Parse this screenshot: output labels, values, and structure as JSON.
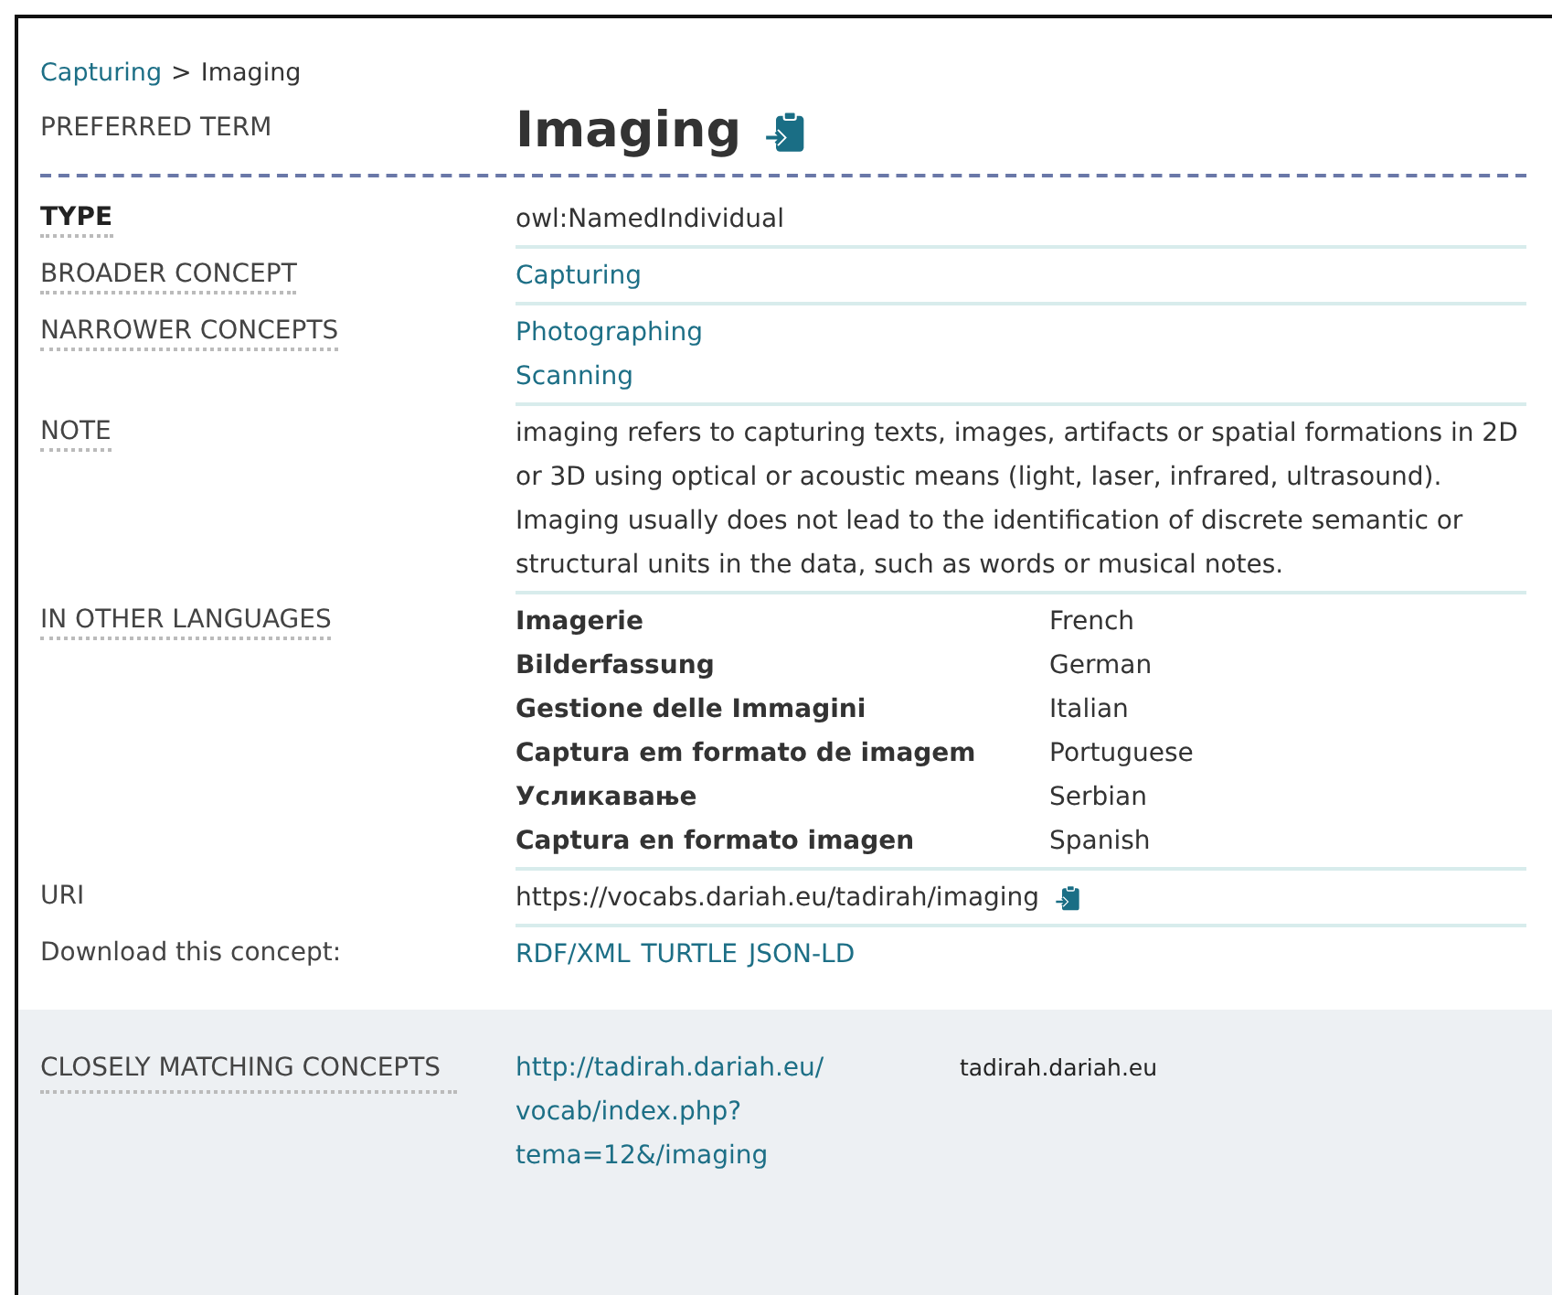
{
  "breadcrumb": {
    "parent": "Capturing",
    "separator": ">",
    "current": "Imaging"
  },
  "preferred_term": {
    "label": "PREFERRED TERM",
    "term": "Imaging"
  },
  "properties": [
    {
      "kind": "text",
      "label": "TYPE",
      "bold": true,
      "dotted": true,
      "values": [
        "owl:NamedIndividual"
      ]
    },
    {
      "kind": "links",
      "label": "BROADER CONCEPT",
      "bold": false,
      "dotted": true,
      "values": [
        "Capturing"
      ]
    },
    {
      "kind": "links",
      "label": "NARROWER CONCEPTS",
      "bold": false,
      "dotted": true,
      "values": [
        "Photographing",
        "Scanning"
      ]
    },
    {
      "kind": "text",
      "label": "NOTE",
      "bold": false,
      "dotted": true,
      "values": [
        "imaging refers to capturing texts, images, artifacts or spatial formations in 2D or 3D using optical or acoustic means (light, laser, infrared, ultrasound). Imaging usually does not lead to the identification of discrete semantic or structural units in the data, such as words or musical notes."
      ]
    },
    {
      "kind": "languages",
      "label": "IN OTHER LANGUAGES",
      "bold": false,
      "dotted": true,
      "languages": [
        {
          "term": "Imagerie",
          "language": "French"
        },
        {
          "term": "Bilderfassung",
          "language": "German"
        },
        {
          "term": "Gestione delle Immagini",
          "language": "Italian"
        },
        {
          "term": "Captura em formato de imagem",
          "language": "Portuguese"
        },
        {
          "term": "Усликавање",
          "language": "Serbian"
        },
        {
          "term": "Captura en formato imagen",
          "language": "Spanish"
        }
      ]
    },
    {
      "kind": "uri",
      "label": "URI",
      "bold": false,
      "dotted": false,
      "values": [
        "https://vocabs.dariah.eu/tadirah/imaging"
      ]
    },
    {
      "kind": "download",
      "label": "Download this concept:",
      "bold": false,
      "dotted": false,
      "values": [
        "RDF/XML",
        "TURTLE",
        "JSON-LD"
      ]
    }
  ],
  "matching": {
    "label": "CLOSELY MATCHING CONCEPTS",
    "link_lines": [
      "http://tadirah.dariah.eu/",
      "vocab/index.php?",
      "tema=12&/imaging"
    ],
    "source": "tadirah.dariah.eu"
  }
}
